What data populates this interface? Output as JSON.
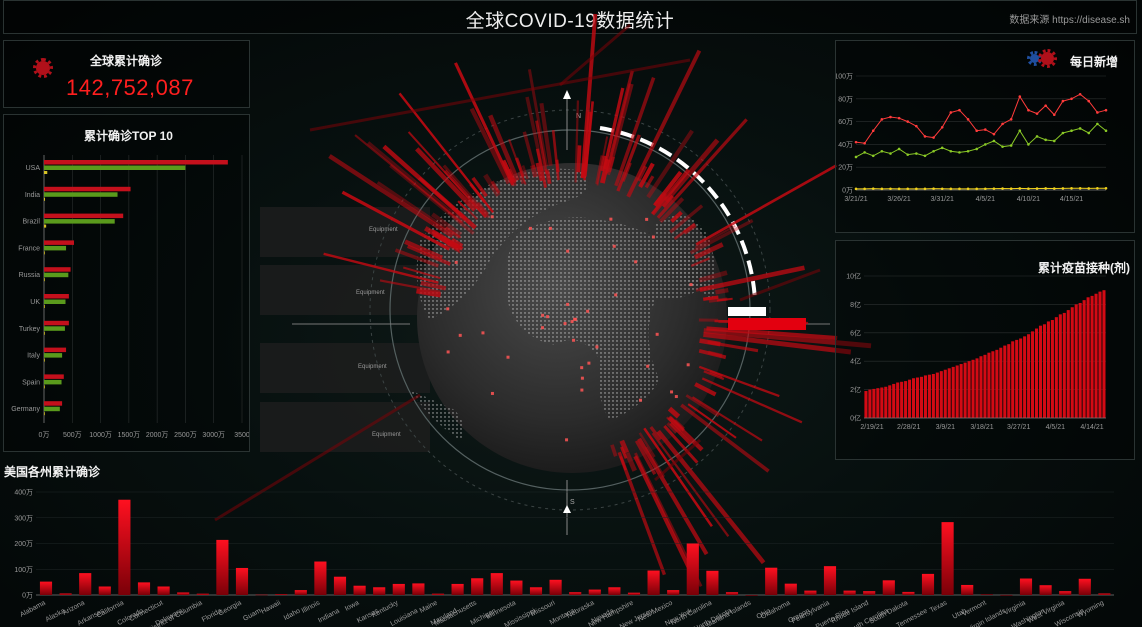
{
  "header": {
    "title": "全球COVID-19数据统计",
    "source": "数据来源 https://disease.sh"
  },
  "total": {
    "label": "全球累计确诊",
    "value": "142,752,087"
  },
  "top10": {
    "title": "累计确诊TOP 10",
    "x_ticks": [
      "0万",
      "500万",
      "1000万",
      "1500万",
      "2000万",
      "2500万",
      "3000万",
      "3500"
    ],
    "countries": [
      "USA",
      "India",
      "Brazil",
      "France",
      "Russia",
      "UK",
      "Turkey",
      "Italy",
      "Spain",
      "Germany"
    ]
  },
  "daily": {
    "title": "每日新增",
    "y_ticks": [
      "100万",
      "80万",
      "60万",
      "40万",
      "20万",
      "0万"
    ],
    "x_ticks": [
      "3/21/21",
      "3/26/21",
      "3/31/21",
      "4/5/21",
      "4/10/21",
      "4/15/21"
    ]
  },
  "vaccine": {
    "title": "累计疫苗接种(剂)",
    "y_ticks": [
      "10亿",
      "8亿",
      "6亿",
      "4亿",
      "2亿",
      "0亿"
    ],
    "x_ticks": [
      "2/19/21",
      "2/28/21",
      "3/9/21",
      "3/18/21",
      "3/27/21",
      "4/5/21",
      "4/14/21"
    ]
  },
  "us_states": {
    "title": "美国各州累计确诊",
    "y_ticks": [
      "400万",
      "300万",
      "200万",
      "100万",
      "0万"
    ]
  },
  "globe": {
    "equipment_labels": [
      "Equipment",
      "Equipment",
      "Equipment",
      "Equipment"
    ],
    "compass_n": "N",
    "compass_s": "S"
  },
  "chart_data": [
    {
      "type": "bar",
      "title": "累计确诊TOP 10",
      "categories": [
        "USA",
        "India",
        "Brazil",
        "France",
        "Russia",
        "UK",
        "Turkey",
        "Italy",
        "Spain",
        "Germany"
      ],
      "xlim": [
        0,
        3500
      ],
      "unit": "万",
      "series": [
        {
          "color": "#c4101c",
          "values": [
            3250,
            1530,
            1400,
            530,
            470,
            440,
            440,
            390,
            350,
            320
          ]
        },
        {
          "color": "#5a9a1c",
          "values": [
            2500,
            1300,
            1250,
            390,
            430,
            380,
            370,
            320,
            310,
            280
          ]
        },
        {
          "color": "#d6c224",
          "values": [
            58,
            18,
            38,
            10,
            10,
            13,
            4,
            12,
            8,
            8
          ]
        }
      ]
    },
    {
      "type": "line",
      "title": "每日新增",
      "x": [
        "3/21/21",
        "3/22/21",
        "3/23/21",
        "3/24/21",
        "3/25/21",
        "3/26/21",
        "3/27/21",
        "3/28/21",
        "3/29/21",
        "3/30/21",
        "3/31/21",
        "4/1/21",
        "4/2/21",
        "4/3/21",
        "4/4/21",
        "4/5/21",
        "4/6/21",
        "4/7/21",
        "4/8/21",
        "4/9/21",
        "4/10/21",
        "4/11/21",
        "4/12/21",
        "4/13/21",
        "4/14/21",
        "4/15/21",
        "4/16/21",
        "4/17/21",
        "4/18/21",
        "4/19/21"
      ],
      "ylim": [
        0,
        100
      ],
      "unit": "万",
      "series": [
        {
          "color": "#ff3b3b",
          "values": [
            42,
            41,
            52,
            62,
            64,
            63,
            60,
            56,
            47,
            46,
            55,
            68,
            70,
            62,
            52,
            53,
            49,
            58,
            62,
            82,
            70,
            67,
            74,
            66,
            78,
            80,
            84,
            78,
            68,
            70
          ]
        },
        {
          "color": "#8ac926",
          "values": [
            29,
            33,
            30,
            34,
            32,
            36,
            31,
            32,
            30,
            34,
            37,
            34,
            33,
            34,
            36,
            40,
            43,
            38,
            39,
            52,
            40,
            47,
            44,
            43,
            50,
            52,
            54,
            50,
            58,
            52
          ]
        },
        {
          "color": "#f1d21c",
          "values": [
            1,
            1,
            1.2,
            1,
            1.1,
            1,
            1,
            1,
            1,
            1.2,
            1.1,
            1,
            1,
            1,
            1,
            1.1,
            1.2,
            1.3,
            1.2,
            1.4,
            1.2,
            1.3,
            1.4,
            1.3,
            1.4,
            1.5,
            1.5,
            1.4,
            1.5,
            1.5
          ]
        }
      ]
    },
    {
      "type": "bar",
      "title": "累计疫苗接种(剂)",
      "ylim": [
        0,
        10
      ],
      "unit": "亿",
      "values": [
        1.9,
        2.0,
        2.05,
        2.1,
        2.15,
        2.2,
        2.3,
        2.4,
        2.5,
        2.55,
        2.6,
        2.7,
        2.8,
        2.85,
        2.9,
        3.0,
        3.05,
        3.1,
        3.2,
        3.3,
        3.4,
        3.5,
        3.6,
        3.7,
        3.8,
        3.9,
        4.0,
        4.1,
        4.2,
        4.35,
        4.45,
        4.6,
        4.7,
        4.8,
        4.95,
        5.1,
        5.2,
        5.4,
        5.5,
        5.6,
        5.75,
        5.9,
        6.1,
        6.3,
        6.5,
        6.6,
        6.8,
        6.9,
        7.1,
        7.3,
        7.4,
        7.6,
        7.8,
        8.0,
        8.1,
        8.3,
        8.5,
        8.6,
        8.75,
        8.9,
        9.0
      ]
    },
    {
      "type": "bar",
      "title": "美国各州累计确诊",
      "ylim": [
        0,
        400
      ],
      "unit": "万",
      "categories": [
        "Alabama",
        "Alaska",
        "Arizona",
        "Arkansas",
        "California",
        "Colorado",
        "Connecticut",
        "Delaware",
        "District of Columbia",
        "Florida",
        "Georgia",
        "Guam",
        "Hawaii",
        "Idaho",
        "Illinois",
        "Indiana",
        "Iowa",
        "Kansas",
        "Kentucky",
        "Louisiana",
        "Maine",
        "Maryland",
        "Massachusetts",
        "Michigan",
        "Minnesota",
        "Mississippi",
        "Missouri",
        "Montana",
        "Nebraska",
        "Nevada",
        "New Hampshire",
        "New Jersey",
        "New Mexico",
        "New York",
        "North Carolina",
        "North Dakota",
        "Northern Mariana Islands",
        "Ohio",
        "Oklahoma",
        "Oregon",
        "Pennsylvania",
        "Puerto Rico",
        "Rhode Island",
        "South Carolina",
        "South Dakota",
        "Tennessee",
        "Texas",
        "Utah",
        "Vermont",
        "Virgin Islands",
        "Virginia",
        "Washington",
        "West Virginia",
        "Wisconsin",
        "Wyoming"
      ],
      "values": [
        52,
        6,
        85,
        33,
        370,
        49,
        33,
        10,
        5,
        214,
        105,
        1,
        3,
        19,
        130,
        71,
        36,
        30,
        43,
        45,
        5,
        43,
        65,
        85,
        56,
        30,
        59,
        11,
        21,
        30,
        9,
        95,
        19,
        200,
        94,
        11,
        0.1,
        106,
        44,
        17,
        112,
        17,
        15,
        57,
        12,
        82,
        283,
        39,
        2,
        0.3,
        64,
        38,
        15,
        63,
        6
      ]
    }
  ]
}
